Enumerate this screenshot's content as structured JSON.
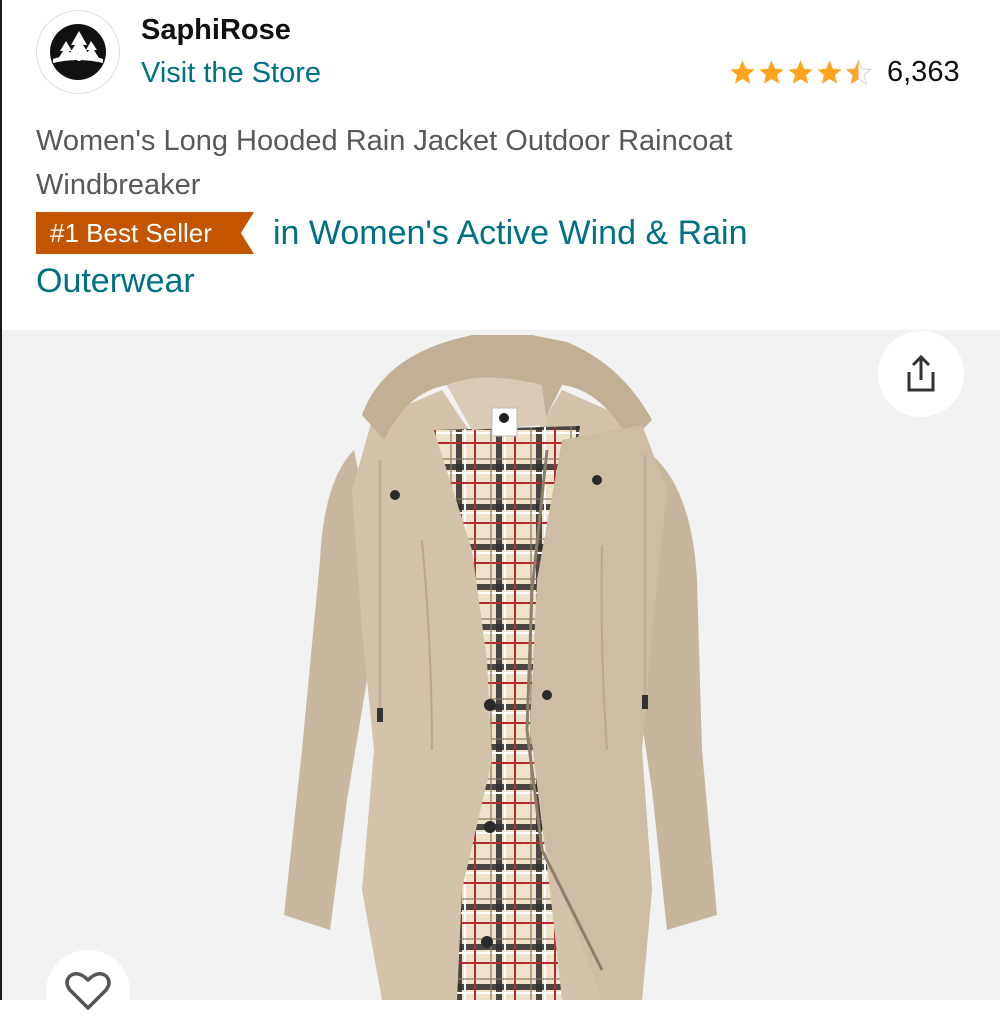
{
  "store": {
    "brand_name": "SaphiRose",
    "visit_link": "Visit the Store",
    "logo_icon": "trees-logo-icon"
  },
  "rating": {
    "stars": 4.5,
    "count": "6,363",
    "star_color": "#ffa41c"
  },
  "product": {
    "title": "Women's Long Hooded Rain Jacket Outdoor Raincoat Windbreaker",
    "badge": "#1 Best Seller",
    "badge_color": "#c45500",
    "category_link": "in Women's Active Wind & Rain Outerwear",
    "link_color": "#007185"
  },
  "image": {
    "alt_subject": "beige hooded rain jacket with plaid lining",
    "share_icon": "share-icon",
    "wishlist_icon": "heart-icon"
  }
}
